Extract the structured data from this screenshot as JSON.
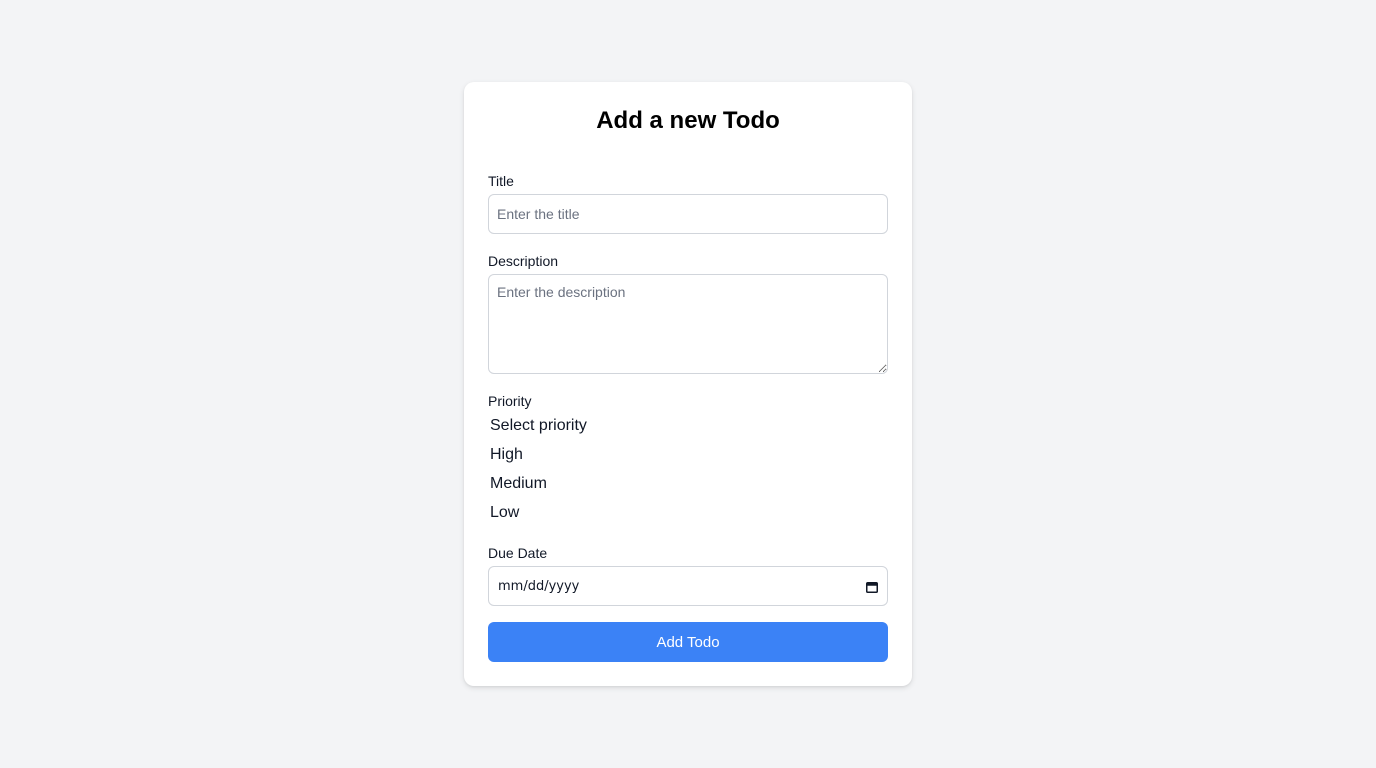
{
  "form": {
    "heading": "Add a new Todo",
    "title": {
      "label": "Title",
      "placeholder": "Enter the title",
      "value": ""
    },
    "description": {
      "label": "Description",
      "placeholder": "Enter the description",
      "value": ""
    },
    "priority": {
      "label": "Priority",
      "options": [
        "Select priority",
        "High",
        "Medium",
        "Low"
      ]
    },
    "due_date": {
      "label": "Due Date",
      "placeholder": "mm/dd/yyyy",
      "icon": "calendar-icon"
    },
    "submit_label": "Add Todo"
  },
  "colors": {
    "background": "#f3f4f6",
    "card": "#ffffff",
    "accent": "#3b82f6",
    "border": "#d1d5db"
  }
}
